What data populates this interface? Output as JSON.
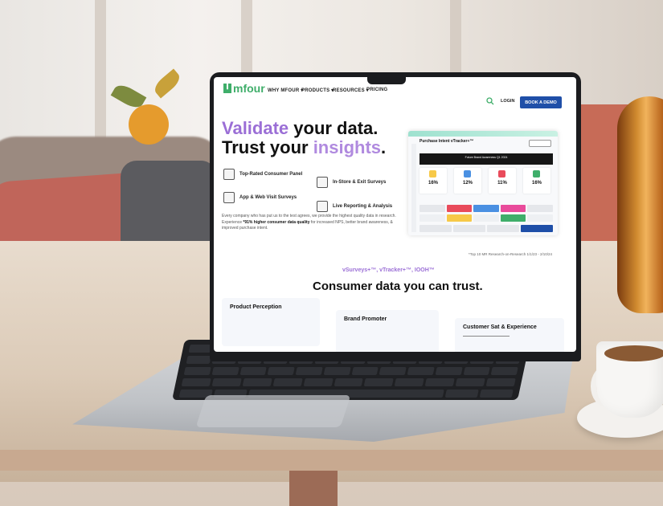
{
  "website": {
    "logo": "mfour",
    "nav": [
      "WHY MFOUR ▾",
      "PRODUCTS ▾",
      "RESOURCES ▾",
      "PRICING"
    ],
    "login": "LOGIN",
    "cta": "BOOK A DEMO",
    "headline_line1_a": "Validate",
    "headline_line1_b": " your data.",
    "headline_line2_a": "Trust your ",
    "headline_line2_b": "insights",
    "headline_line2_c": ".",
    "features": [
      "Top-Rated Consumer Panel",
      "In-Store & Exit Surveys",
      "App & Web Visit Surveys",
      "Live Reporting & Analysis"
    ],
    "body_a": "Every company who has put us to the test agrees, we provide the highest quality data in research. Experience ",
    "body_bold": "*91% higher consumer data quality",
    "body_b": " for increased NPS, better brand awareness, & improved purchase intent.",
    "dashboard": {
      "title": "Purchase Intent vTracker+™",
      "banner": "Future Brand Awareness Q1 2024",
      "stats": [
        "16%",
        "12%",
        "11%",
        "16%"
      ]
    },
    "footnote": "*Top 10 MR Research-on-Research 1/1/23 - 2/10/24",
    "tagline": "vSurveys+™, vTracker+™, IOOH™",
    "subhead": "Consumer data you can trust.",
    "cards": [
      "Product Perception",
      "Brand Promoter",
      "Customer Sat & Experience"
    ]
  },
  "colors": {
    "brand_green": "#3fae6a",
    "cta_blue": "#1f4fa8",
    "accent_purple": "#9b6fd6"
  }
}
